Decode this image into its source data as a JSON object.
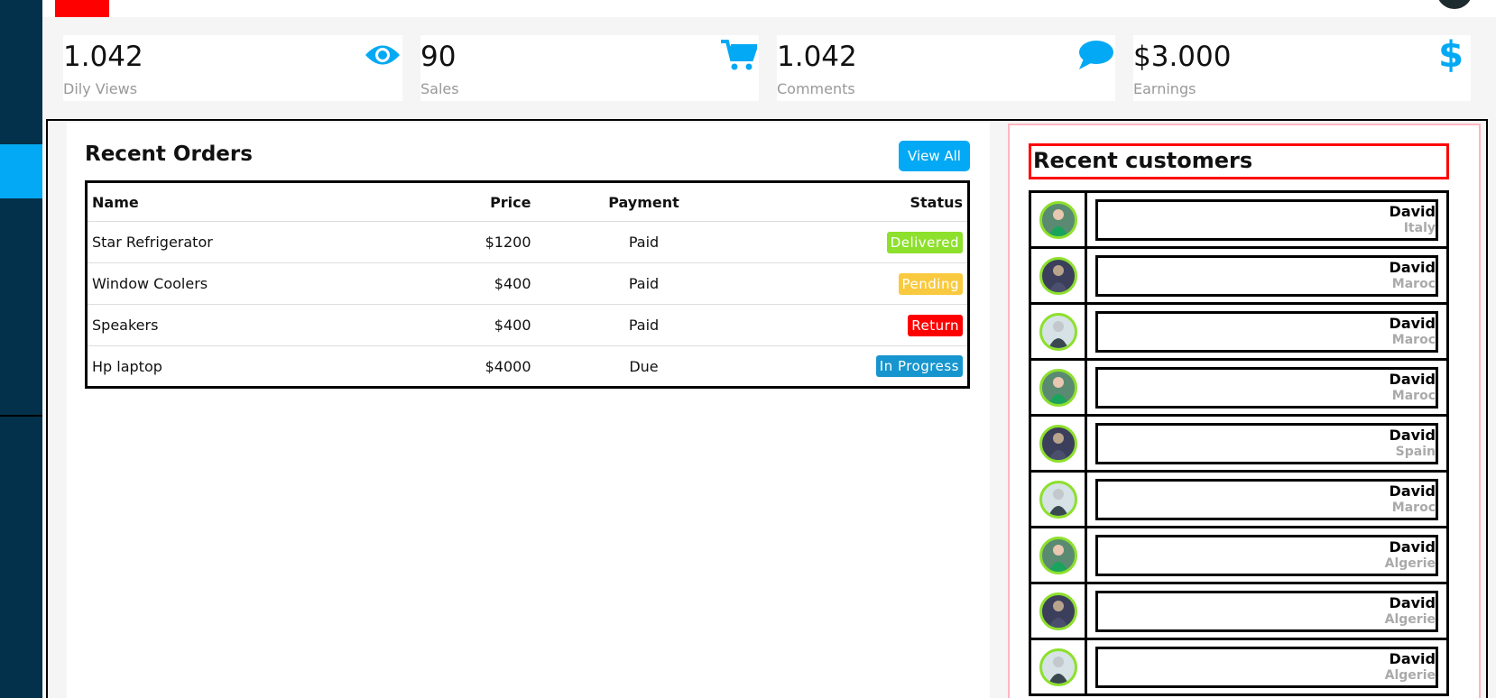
{
  "cards": [
    {
      "value": "1.042",
      "label": "Dily Views",
      "icon": "eye-icon"
    },
    {
      "value": "90",
      "label": "Sales",
      "icon": "cart-icon"
    },
    {
      "value": "1.042",
      "label": "Comments",
      "icon": "comment-icon"
    },
    {
      "value": "$3.000",
      "label": "Earnings",
      "icon": "dollar-icon"
    }
  ],
  "accent_color": "#03a9f4",
  "orders": {
    "title": "Recent Orders",
    "view_all": "View All",
    "headers": {
      "name": "Name",
      "price": "Price",
      "payment": "Payment",
      "status": "Status"
    },
    "rows": [
      {
        "name": "Star Refrigerator",
        "price": "$1200",
        "payment": "Paid",
        "status": "Delivered",
        "status_color": "#8de02c"
      },
      {
        "name": "Window Coolers",
        "price": "$400",
        "payment": "Paid",
        "status": "Pending",
        "status_color": "#f9ca3f"
      },
      {
        "name": "Speakers",
        "price": "$400",
        "payment": "Paid",
        "status": "Return",
        "status_color": "#ff0000"
      },
      {
        "name": "Hp laptop",
        "price": "$4000",
        "payment": "Due",
        "status": "In Progress",
        "status_color": "#1795ce"
      }
    ]
  },
  "customers": {
    "title": "Recent customers",
    "rows": [
      {
        "name": "David",
        "country": "Italy"
      },
      {
        "name": "David",
        "country": "Maroc"
      },
      {
        "name": "David",
        "country": "Maroc"
      },
      {
        "name": "David",
        "country": "Maroc"
      },
      {
        "name": "David",
        "country": "Spain"
      },
      {
        "name": "David",
        "country": "Maroc"
      },
      {
        "name": "David",
        "country": "Algerie"
      },
      {
        "name": "David",
        "country": "Algerie"
      },
      {
        "name": "David",
        "country": "Algerie"
      }
    ]
  }
}
